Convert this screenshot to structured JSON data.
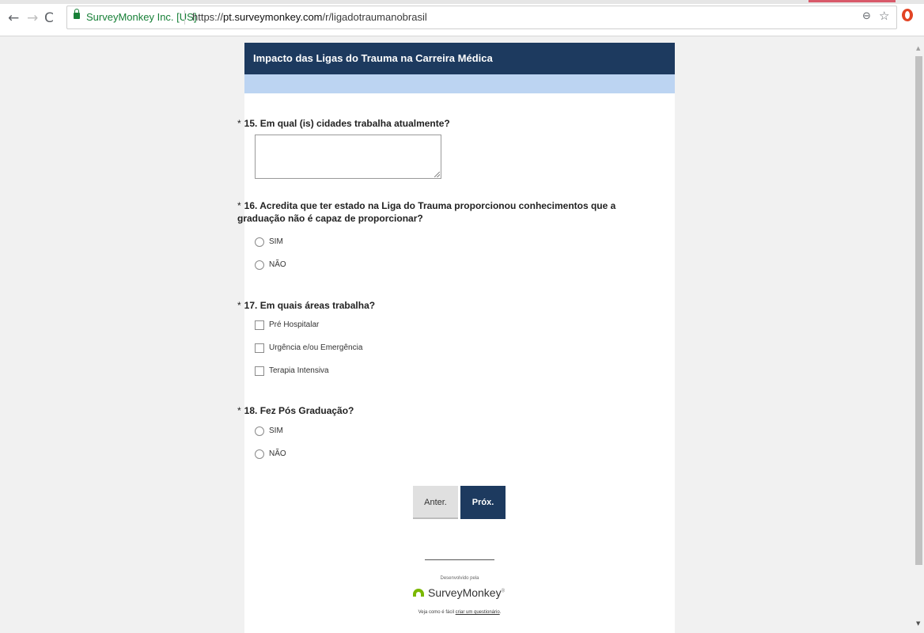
{
  "browser": {
    "site_identity": "SurveyMonkey Inc. [US]",
    "url_scheme": "https://",
    "url_host": "pt.surveymonkey.com",
    "url_path": "/r/ligadotraumanobrasil",
    "back_icon": "←",
    "forward_icon": "→",
    "reload_icon": "C",
    "zoom_icon": "⊖",
    "star_icon": "☆"
  },
  "survey": {
    "title": "Impacto das Ligas do Trauma na Carreira Médica",
    "required_marker": "*",
    "q15": {
      "label": "15. Em qual (is) cidades trabalha atualmente?",
      "value": ""
    },
    "q16": {
      "label": "16. Acredita que ter estado na Liga do Trauma proporcionou conhecimentos que a graduação não é capaz de proporcionar?",
      "options": [
        "SIM",
        "NÃO"
      ]
    },
    "q17": {
      "label": "17. Em quais áreas trabalha?",
      "options": [
        "Pré Hospitalar",
        "Urgência e/ou Emergência",
        "Terapia Intensiva"
      ]
    },
    "q18": {
      "label": "18. Fez Pós Graduação?",
      "options": [
        "SIM",
        "NÃO"
      ]
    },
    "buttons": {
      "prev": "Anter.",
      "next": "Próx."
    }
  },
  "footer": {
    "powered_by": "Desenvolvido pela",
    "brand": "SurveyMonkey",
    "brand_mark": "®",
    "cta_prefix": "Veja como é fácil ",
    "cta_link": "criar um questionário",
    "cta_suffix": "."
  },
  "colors": {
    "header": "#1d3a5f",
    "progress_strip": "#bcd4f2",
    "brand_green": "#7ab800"
  }
}
